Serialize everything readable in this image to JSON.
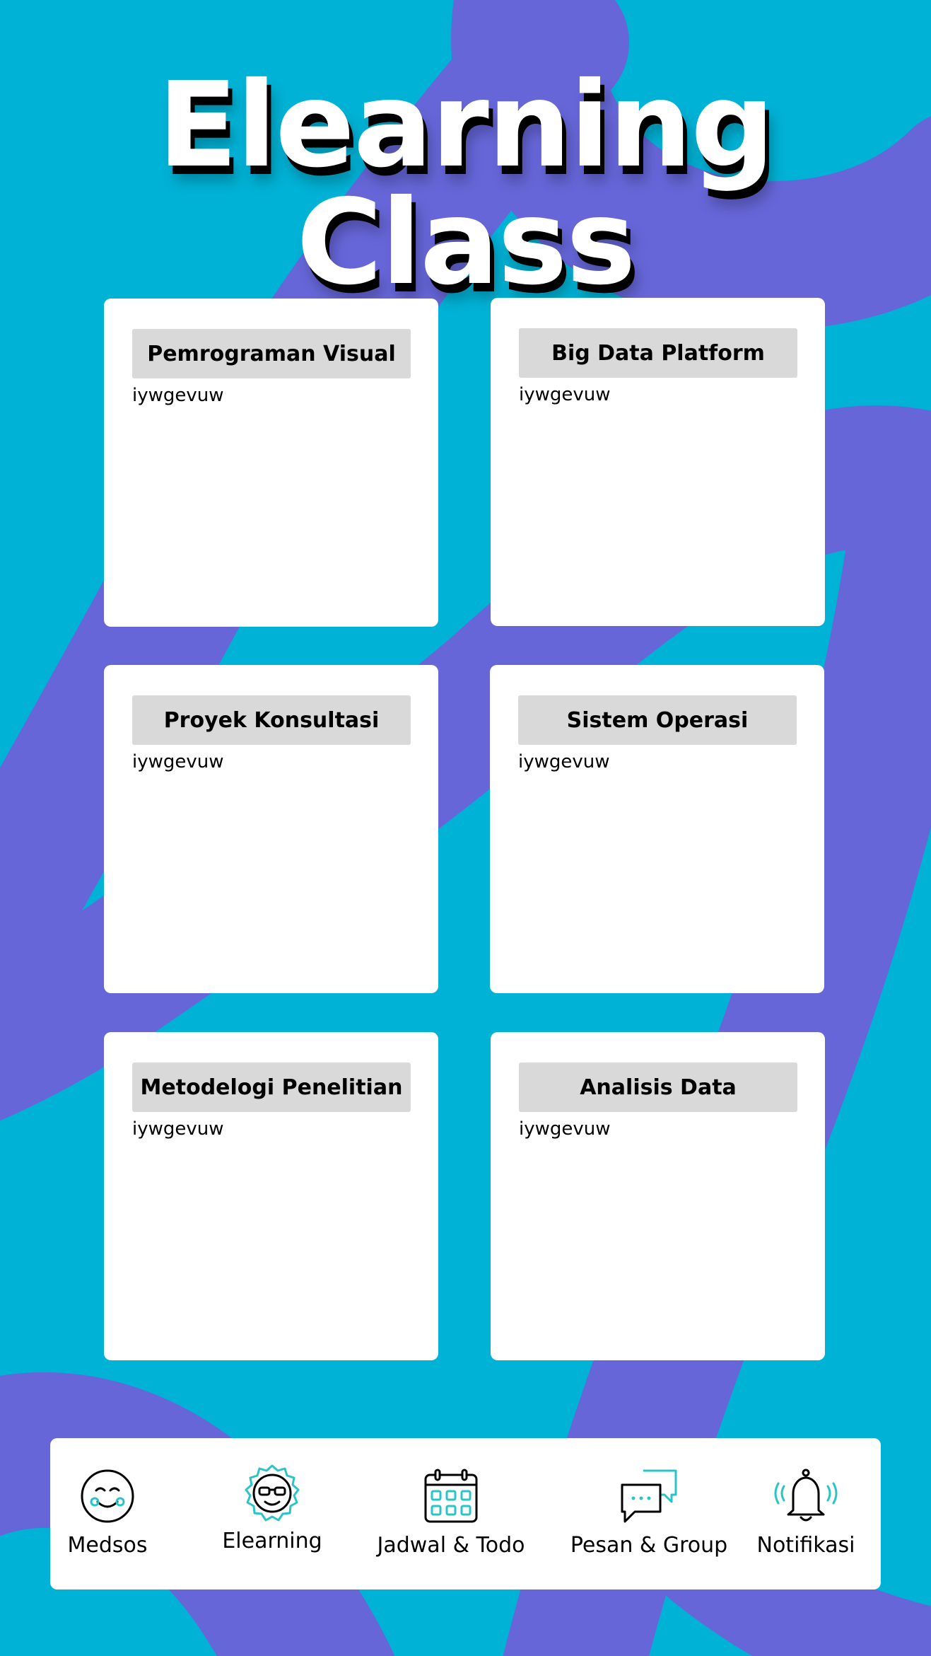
{
  "page": {
    "title": "Elearning Class"
  },
  "colors": {
    "background": "#00B2D6",
    "swoosh": "#6666D9",
    "accent": "#2BC4C6",
    "card_header": "#D9D9D9"
  },
  "courses": [
    {
      "name": "Pemrograman Visual",
      "subtitle": "iywgevuw"
    },
    {
      "name": "Big Data Platform",
      "subtitle": "iywgevuw"
    },
    {
      "name": "Proyek Konsultasi",
      "subtitle": "iywgevuw"
    },
    {
      "name": "Sistem Operasi",
      "subtitle": "iywgevuw"
    },
    {
      "name": "Metodelogi Penelitian",
      "subtitle": "iywgevuw"
    },
    {
      "name": "Analisis Data",
      "subtitle": "iywgevuw"
    }
  ],
  "nav": {
    "items": [
      {
        "label": "Medsos",
        "icon": "smiley-icon"
      },
      {
        "label": "Elearning",
        "icon": "nerd-face-icon",
        "active": true
      },
      {
        "label": "Jadwal & Todo",
        "icon": "calendar-icon"
      },
      {
        "label": "Pesan & Group",
        "icon": "chat-bubbles-icon"
      },
      {
        "label": "Notifikasi",
        "icon": "bell-icon"
      }
    ]
  }
}
